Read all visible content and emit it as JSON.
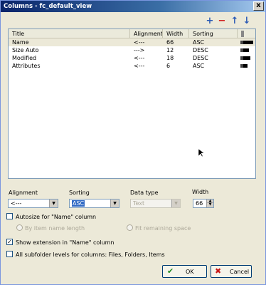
{
  "window": {
    "title": "Columns - fc_default_view",
    "close_glyph": "x"
  },
  "toolbar": {
    "add_glyph": "+",
    "remove_glyph": "−",
    "up_glyph": "↑",
    "down_glyph": "↓",
    "add_color": "#2a5ab5",
    "remove_color": "#d01818",
    "arrow_color": "#2a5ab5"
  },
  "columns_list": {
    "headers": [
      "Title",
      "Alignment",
      "Width",
      "Sorting"
    ],
    "rows": [
      {
        "title": "Name",
        "alignment": "<---",
        "width": "66",
        "sorting": "ASC",
        "selected": true
      },
      {
        "title": "Size Auto",
        "alignment": "--->",
        "width": "12",
        "sorting": "DESC",
        "selected": false
      },
      {
        "title": "Modified",
        "alignment": "<---",
        "width": "18",
        "sorting": "DESC",
        "selected": false
      },
      {
        "title": "Attributes",
        "alignment": "<---",
        "width": "6",
        "sorting": "ASC",
        "selected": false
      }
    ]
  },
  "form": {
    "alignment_label": "Alignment",
    "alignment_value": "<---",
    "sorting_label": "Sorting",
    "sorting_value": "ASC",
    "datatype_label": "Data type",
    "datatype_value": "Text",
    "width_label": "Width",
    "width_value": "66",
    "autosize_label": "Autosize for \"Name\" column",
    "by_item_name_label": "By item name length",
    "fit_remaining_label": "Fit remaining space",
    "show_extension_label": "Show extension in \"Name\" column",
    "all_subfolder_label": "All subfolder levels for columns:  Files, Folders, Items",
    "check_glyph": "✓"
  },
  "buttons": {
    "ok_label": "OK",
    "ok_glyph": "✔",
    "ok_color": "#1e8a1e",
    "cancel_label": "Cancel",
    "cancel_glyph": "✖",
    "cancel_color": "#c81818"
  }
}
